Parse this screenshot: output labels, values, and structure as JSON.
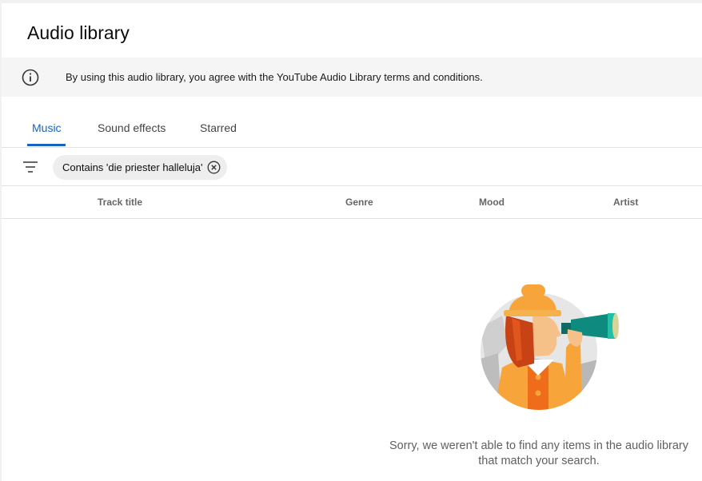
{
  "header": {
    "title": "Audio library"
  },
  "notice": {
    "icon": "info-icon",
    "text": "By using this audio library, you agree with the YouTube Audio Library terms and conditions."
  },
  "tabs": [
    {
      "label": "Music",
      "active": true
    },
    {
      "label": "Sound effects",
      "active": false
    },
    {
      "label": "Starred",
      "active": false
    }
  ],
  "filter": {
    "icon": "filter-icon",
    "chip_label": "Contains 'die priester halleluja'",
    "chip_close_icon": "close-circle-icon"
  },
  "table": {
    "columns": [
      "Track title",
      "Genre",
      "Mood",
      "Artist"
    ]
  },
  "empty_state": {
    "illustration": "explorer-with-binoculars-illustration",
    "message": "Sorry, we weren't able to find any items in the audio library that match your search."
  },
  "colors": {
    "accent": "#1565c0",
    "notice_bg": "#f5f5f5",
    "chip_bg": "#eeeeee"
  }
}
